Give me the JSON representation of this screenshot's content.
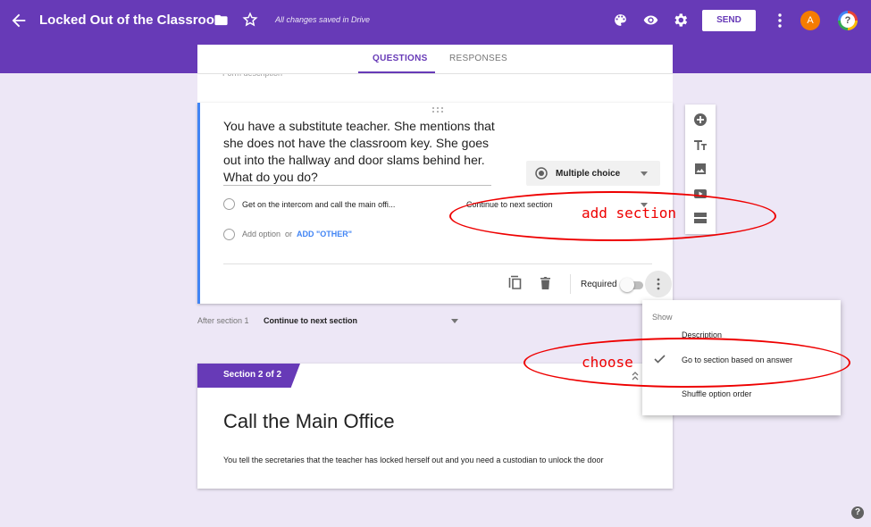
{
  "header": {
    "title": "Locked Out of the Classroom",
    "saved_status": "All changes saved in Drive",
    "send_label": "SEND",
    "avatar_letter": "A",
    "help_glyph": "?",
    "icons": [
      "back-arrow-icon",
      "folder-icon",
      "star-icon",
      "palette-icon",
      "eye-icon",
      "gear-icon",
      "more-vert-icon"
    ]
  },
  "tabs": {
    "questions": "QUESTIONS",
    "responses": "RESPONSES",
    "active": "QUESTIONS"
  },
  "form": {
    "description_placeholder": "Form description"
  },
  "question": {
    "title": "You have a substitute teacher. She mentions that she does not have the classroom key. She goes out into the hallway and door slams behind her. What do you do?",
    "type": "Multiple choice",
    "option_1": "Get on the intercom and call the main offi...",
    "option_1_goto": "Continue to next section",
    "add_option": "Add option",
    "or_text": "or",
    "add_other": "ADD \"OTHER\"",
    "required_label": "Required",
    "required_on": false
  },
  "toolbar": {
    "items": [
      "add-question-icon",
      "add-title-icon",
      "add-image-icon",
      "add-video-icon",
      "add-section-icon"
    ]
  },
  "after_section": {
    "label": "After section 1",
    "value": "Continue to next section"
  },
  "section2": {
    "tab_label": "Section 2 of 2",
    "title": "Call the Main Office",
    "description": "You tell the secretaries that the teacher has locked herself out and you need a custodian to unlock the door"
  },
  "menu": {
    "header": "Show",
    "item_description": "Description",
    "item_goto": "Go to section based on answer",
    "item_shuffle": "Shuffle option order",
    "checked_item": "Go to section based on answer"
  },
  "annotations": {
    "add_section": "add section",
    "choose": "choose",
    "color": "#ee0000"
  },
  "colors": {
    "brand": "#673ab7",
    "accent_blue": "#4285f4",
    "background": "#ede7f6"
  }
}
